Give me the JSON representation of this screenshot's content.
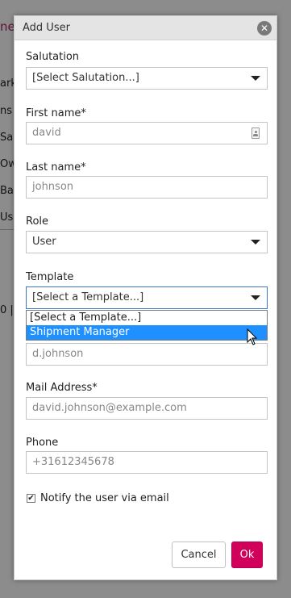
{
  "background_fragments": [
    "ne",
    "ark",
    "ns",
    "Sa",
    "Ow",
    "Ba",
    "Us",
    "0 |"
  ],
  "dialog": {
    "title": "Add User",
    "close_symbol": "✕"
  },
  "form": {
    "salutation": {
      "label": "Salutation",
      "value": "[Select Salutation...]"
    },
    "first_name": {
      "label": "First name*",
      "placeholder": "david"
    },
    "last_name": {
      "label": "Last name*",
      "placeholder": "johnson"
    },
    "role": {
      "label": "Role",
      "value": "User"
    },
    "template": {
      "label": "Template",
      "value": "[Select a Template...]",
      "options": [
        "[Select a Template...]",
        "Shipment Manager"
      ],
      "highlighted_option": "Shipment Manager"
    },
    "username": {
      "placeholder": "d.johnson"
    },
    "mail": {
      "label": "Mail Address*",
      "placeholder": "david.johnson@example.com"
    },
    "phone": {
      "label": "Phone",
      "placeholder": "+31612345678"
    },
    "notify": {
      "label": "Notify the user via email",
      "checked": true
    }
  },
  "buttons": {
    "cancel": "Cancel",
    "ok": "Ok"
  },
  "colors": {
    "accent": "#d1005a",
    "selection": "#1e90ff",
    "title_bar": "#e4e4e4"
  }
}
